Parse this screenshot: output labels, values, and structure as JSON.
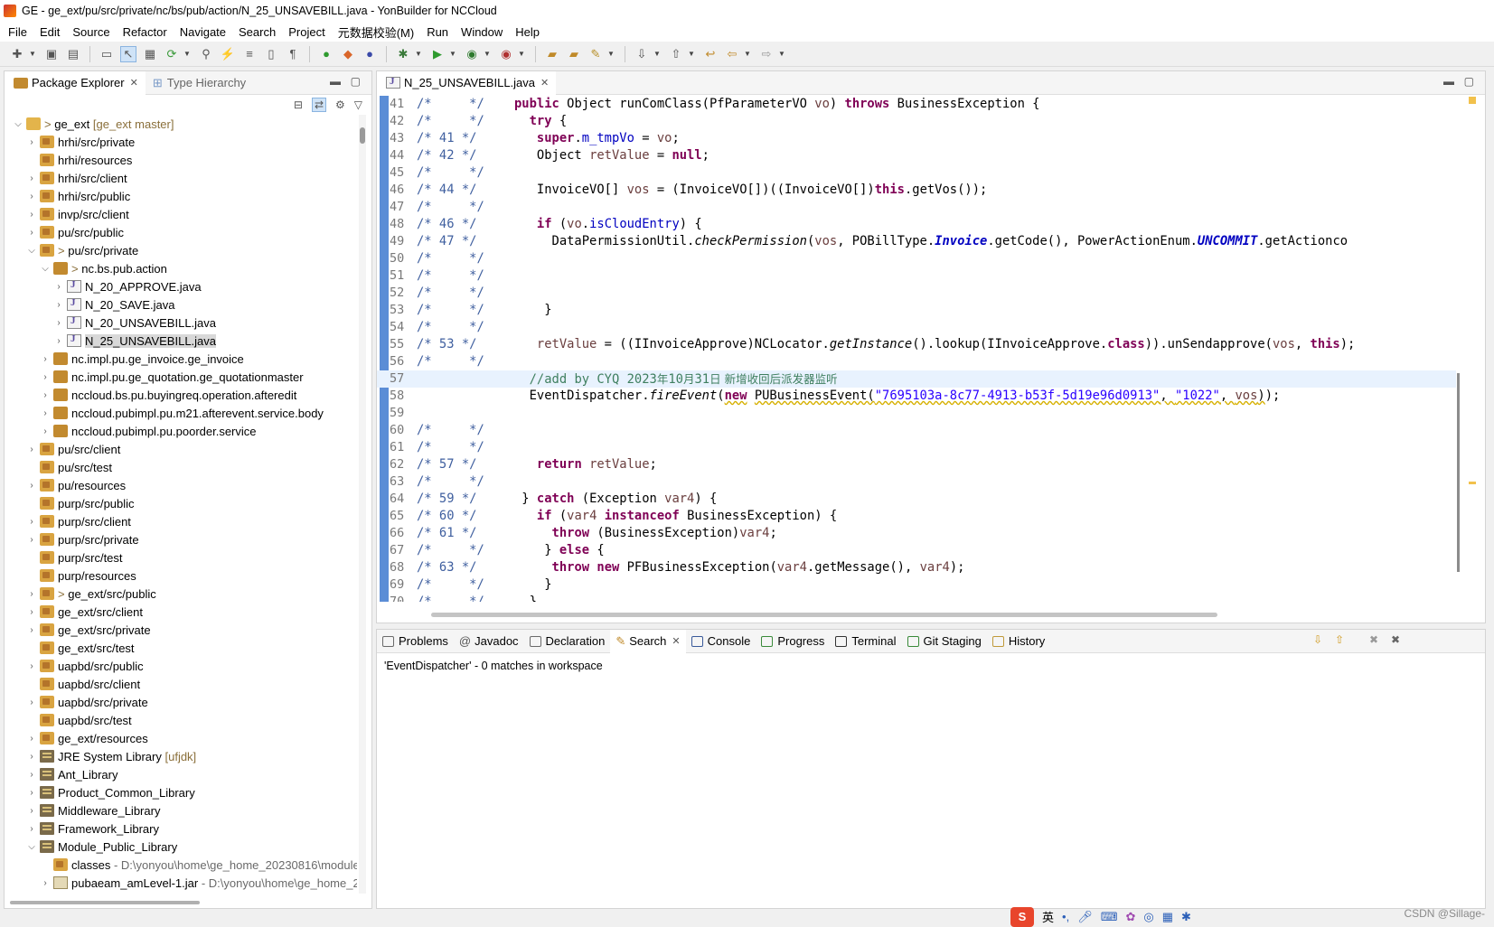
{
  "window": {
    "title": "GE - ge_ext/pu/src/private/nc/bs/pub/action/N_25_UNSAVEBILL.java - YonBuilder for NCCloud"
  },
  "menu": [
    "File",
    "Edit",
    "Source",
    "Refactor",
    "Navigate",
    "Search",
    "Project",
    "元数据校验(M)",
    "Run",
    "Window",
    "Help"
  ],
  "left_panel": {
    "tab_active": "Package Explorer",
    "tab_inactive": "Type Hierarchy",
    "tree": [
      {
        "depth": 0,
        "twisty": "open",
        "icon": "project",
        "prefix": "> ",
        "label": "ge_ext",
        "suffix": " [ge_ext master]"
      },
      {
        "depth": 1,
        "twisty": "closed",
        "icon": "pkgfolder",
        "label": "hrhi/src/private"
      },
      {
        "depth": 1,
        "twisty": "none",
        "icon": "pkgfolder",
        "label": "hrhi/resources"
      },
      {
        "depth": 1,
        "twisty": "closed",
        "icon": "pkgfolder",
        "label": "hrhi/src/client"
      },
      {
        "depth": 1,
        "twisty": "closed",
        "icon": "pkgfolder",
        "label": "hrhi/src/public"
      },
      {
        "depth": 1,
        "twisty": "closed",
        "icon": "pkgfolder",
        "label": "invp/src/client"
      },
      {
        "depth": 1,
        "twisty": "closed",
        "icon": "pkgfolder",
        "label": "pu/src/public"
      },
      {
        "depth": 1,
        "twisty": "open",
        "icon": "pkgfolder",
        "prefix": "> ",
        "label": "pu/src/private"
      },
      {
        "depth": 2,
        "twisty": "open",
        "icon": "package",
        "prefix": "> ",
        "label": "nc.bs.pub.action"
      },
      {
        "depth": 3,
        "twisty": "closed",
        "icon": "javafile",
        "label": "N_20_APPROVE.java"
      },
      {
        "depth": 3,
        "twisty": "closed",
        "icon": "javafile",
        "label": "N_20_SAVE.java"
      },
      {
        "depth": 3,
        "twisty": "closed",
        "icon": "javafile",
        "label": "N_20_UNSAVEBILL.java"
      },
      {
        "depth": 3,
        "twisty": "closed",
        "icon": "javafile",
        "label": "N_25_UNSAVEBILL.java",
        "selected": true
      },
      {
        "depth": 2,
        "twisty": "closed",
        "icon": "package",
        "label": "nc.impl.pu.ge_invoice.ge_invoice"
      },
      {
        "depth": 2,
        "twisty": "closed",
        "icon": "package",
        "label": "nc.impl.pu.ge_quotation.ge_quotationmaster"
      },
      {
        "depth": 2,
        "twisty": "closed",
        "icon": "package",
        "label": "nccloud.bs.pu.buyingreq.operation.afteredit"
      },
      {
        "depth": 2,
        "twisty": "closed",
        "icon": "package",
        "label": "nccloud.pubimpl.pu.m21.afterevent.service.body"
      },
      {
        "depth": 2,
        "twisty": "closed",
        "icon": "package",
        "label": "nccloud.pubimpl.pu.poorder.service"
      },
      {
        "depth": 1,
        "twisty": "closed",
        "icon": "pkgfolder",
        "label": "pu/src/client"
      },
      {
        "depth": 1,
        "twisty": "none",
        "icon": "pkgfolder",
        "label": "pu/src/test"
      },
      {
        "depth": 1,
        "twisty": "closed",
        "icon": "pkgfolder",
        "label": "pu/resources"
      },
      {
        "depth": 1,
        "twisty": "none",
        "icon": "pkgfolder",
        "label": "purp/src/public"
      },
      {
        "depth": 1,
        "twisty": "closed",
        "icon": "pkgfolder",
        "label": "purp/src/client"
      },
      {
        "depth": 1,
        "twisty": "closed",
        "icon": "pkgfolder",
        "label": "purp/src/private"
      },
      {
        "depth": 1,
        "twisty": "none",
        "icon": "pkgfolder",
        "label": "purp/src/test"
      },
      {
        "depth": 1,
        "twisty": "none",
        "icon": "pkgfolder",
        "label": "purp/resources"
      },
      {
        "depth": 1,
        "twisty": "closed",
        "icon": "pkgfolder",
        "prefix": "> ",
        "label": "ge_ext/src/public"
      },
      {
        "depth": 1,
        "twisty": "closed",
        "icon": "pkgfolder",
        "label": "ge_ext/src/client"
      },
      {
        "depth": 1,
        "twisty": "closed",
        "icon": "pkgfolder",
        "label": "ge_ext/src/private"
      },
      {
        "depth": 1,
        "twisty": "none",
        "icon": "pkgfolder",
        "label": "ge_ext/src/test"
      },
      {
        "depth": 1,
        "twisty": "closed",
        "icon": "pkgfolder",
        "label": "uapbd/src/public"
      },
      {
        "depth": 1,
        "twisty": "none",
        "icon": "pkgfolder",
        "label": "uapbd/src/client"
      },
      {
        "depth": 1,
        "twisty": "closed",
        "icon": "pkgfolder",
        "label": "uapbd/src/private"
      },
      {
        "depth": 1,
        "twisty": "none",
        "icon": "pkgfolder",
        "label": "uapbd/src/test"
      },
      {
        "depth": 1,
        "twisty": "closed",
        "icon": "pkgfolder",
        "label": "ge_ext/resources"
      },
      {
        "depth": 1,
        "twisty": "closed",
        "icon": "library",
        "label": "JRE System Library",
        "suffix": " [ufjdk]"
      },
      {
        "depth": 1,
        "twisty": "closed",
        "icon": "library",
        "label": "Ant_Library"
      },
      {
        "depth": 1,
        "twisty": "closed",
        "icon": "library",
        "label": "Product_Common_Library"
      },
      {
        "depth": 1,
        "twisty": "closed",
        "icon": "library",
        "label": "Middleware_Library"
      },
      {
        "depth": 1,
        "twisty": "closed",
        "icon": "library",
        "label": "Framework_Library"
      },
      {
        "depth": 1,
        "twisty": "open",
        "icon": "library",
        "label": "Module_Public_Library"
      },
      {
        "depth": 2,
        "twisty": "none",
        "icon": "pkgfolder",
        "label": "classes",
        "path": " - D:\\yonyou\\home\\ge_home_20230816\\module"
      },
      {
        "depth": 2,
        "twisty": "closed",
        "icon": "jar",
        "label": "pubaeam_amLevel-1.jar",
        "path": " - D:\\yonyou\\home\\ge_home_2"
      }
    ]
  },
  "editor": {
    "tab_label": "N_25_UNSAVEBILL.java",
    "line_numbers": [
      "41",
      "42",
      "43",
      "44",
      "45",
      "46",
      "47",
      "48",
      "49",
      "50",
      "51",
      "52",
      "53",
      "54",
      "55",
      "56",
      "57",
      "58",
      "59",
      "60",
      "61",
      "62",
      "63",
      "64",
      "65",
      "66",
      "67",
      "68",
      "69",
      "70"
    ],
    "current_line_index": 16
  },
  "bottom_panel": {
    "tabs": [
      "Problems",
      "Javadoc",
      "Declaration",
      "Search",
      "Console",
      "Progress",
      "Terminal",
      "Git Staging",
      "History"
    ],
    "active_tab": "Search",
    "search_result": "'EventDispatcher' - 0 matches in workspace"
  },
  "ime_bar": {
    "lang": "英"
  },
  "watermark": "CSDN @Sillage-"
}
